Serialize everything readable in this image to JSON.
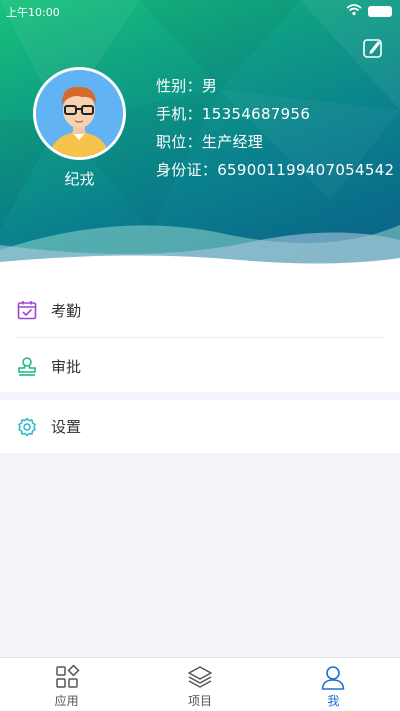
{
  "status_bar": {
    "time": "上午10:00"
  },
  "profile": {
    "name": "纪戎",
    "gender_label": "性别：",
    "gender": "男",
    "phone_label": "手机：",
    "phone": "15354687956",
    "position_label": "职位：",
    "position": "生产经理",
    "id_label": "身份证：",
    "id_number": "659001199407054542"
  },
  "menu": {
    "attendance": "考勤",
    "approval": "审批",
    "settings": "设置"
  },
  "tabs": [
    {
      "label": "应用",
      "icon": "apps-icon"
    },
    {
      "label": "项目",
      "icon": "layers-icon"
    },
    {
      "label": "我",
      "icon": "user-icon",
      "active": true
    }
  ],
  "colors": {
    "accent": "#1e6fd6",
    "header_start": "#18c27a",
    "header_end": "#0b5f86"
  }
}
